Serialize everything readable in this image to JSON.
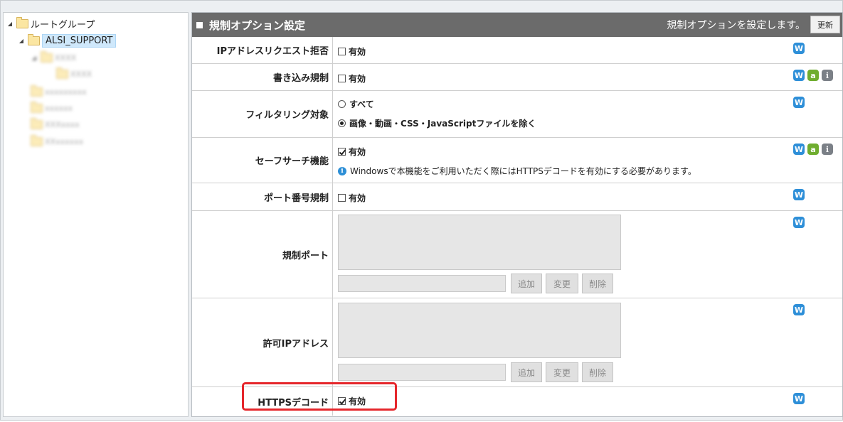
{
  "tree": {
    "root_label": "ルートグループ",
    "selected_label": "ALSI_SUPPORT",
    "blurred_items": [
      "XXXX",
      "XXXX",
      "xxxxxxxxx",
      "xxxxxx",
      "XXXxxxx",
      "XXxxxxxx"
    ]
  },
  "panel": {
    "title": "規制オプション設定",
    "description": "規制オプションを設定します。",
    "refresh_label": "更新"
  },
  "options": {
    "ip_request_reject": {
      "label": "IPアドレスリクエスト拒否",
      "checkbox_label": "有効",
      "checked": false
    },
    "write_restriction": {
      "label": "書き込み規制",
      "checkbox_label": "有効",
      "checked": false
    },
    "filtering_target": {
      "label": "フィルタリング対象",
      "options": [
        "すべて",
        "画像・動画・CSS・JavaScriptファイルを除く"
      ],
      "selected_index": 1
    },
    "safe_search": {
      "label": "セーフサーチ機能",
      "checkbox_label": "有効",
      "checked": true,
      "note": "Windowsで本機能をご利用いただく際にはHTTPSデコードを有効にする必要があります。"
    },
    "port_restriction": {
      "label": "ポート番号規制",
      "checkbox_label": "有効",
      "checked": false
    },
    "restricted_ports": {
      "label": "規制ポート",
      "input_value": "",
      "add_label": "追加",
      "change_label": "変更",
      "delete_label": "削除"
    },
    "allowed_ips": {
      "label": "許可IPアドレス",
      "input_value": "",
      "add_label": "追加",
      "change_label": "変更",
      "delete_label": "削除"
    },
    "https_decode": {
      "label": "HTTPSデコード",
      "checkbox_label": "有効",
      "checked": true
    }
  },
  "icons": {
    "w": "W",
    "a": "a",
    "i": "i"
  },
  "colors": {
    "header_bg": "#6b6b6b",
    "selected_node": "#cfe8fb",
    "highlight": "#e5262b",
    "w_icon": "#2e8fd8",
    "a_icon": "#6fad2f",
    "i_icon": "#7b8087"
  }
}
